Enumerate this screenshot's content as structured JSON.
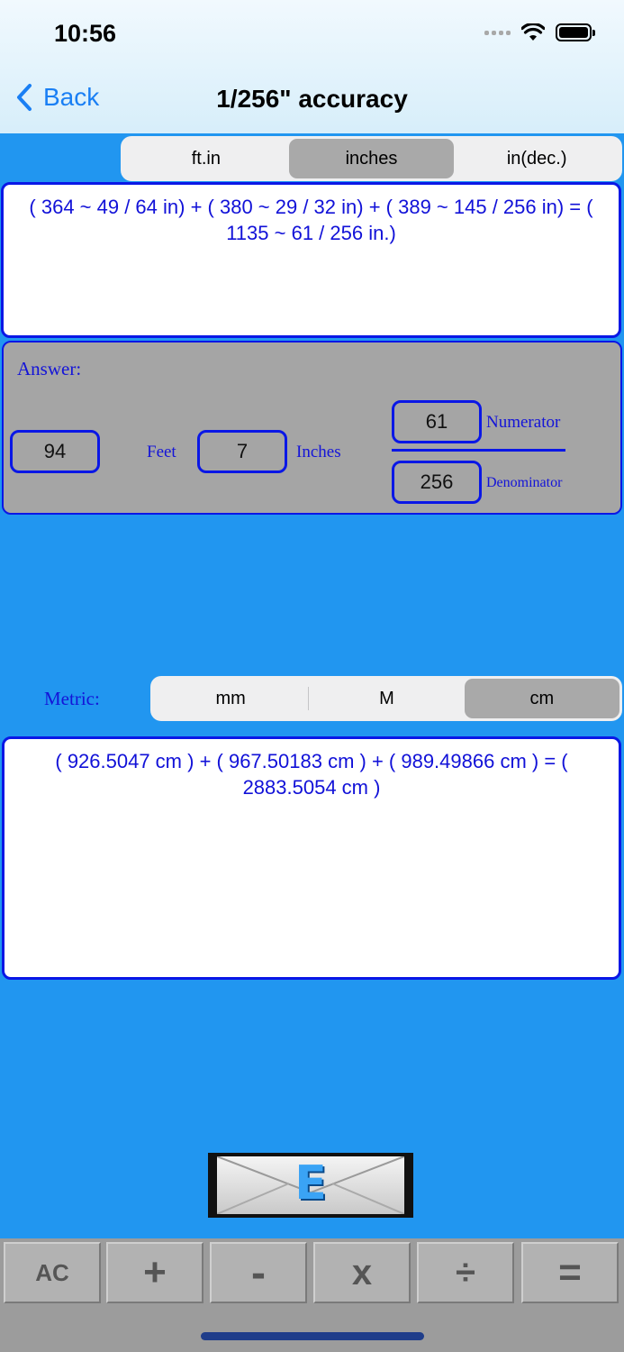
{
  "status_bar": {
    "time": "10:56"
  },
  "nav": {
    "back_label": "Back",
    "title": "1/256\" accuracy"
  },
  "imperial_units": {
    "options": [
      "ft.in",
      "inches",
      "in(dec.)"
    ],
    "selected": "inches"
  },
  "imperial_expression": "( 364 ~ 49 / 64 in)  +  ( 380 ~ 29 / 32 in)  +  ( 389 ~ 145 / 256 in)  =  ( 1135 ~ 61 / 256 in.)",
  "answer": {
    "heading": "Answer:",
    "feet_value": "94",
    "feet_label": "Feet",
    "inches_value": "7",
    "inches_label": "Inches",
    "numerator_value": "61",
    "numerator_label": "Numerator",
    "denominator_value": "256",
    "denominator_label": "Denominator"
  },
  "metric": {
    "label": "Metric:",
    "options": [
      "mm",
      "M",
      "cm"
    ],
    "selected": "cm",
    "expression": "( 926.5047 cm )  +  ( 967.50183 cm )  +  ( 989.49866 cm )  =  ( 2883.5054 cm )"
  },
  "email_button": {
    "letter": "E",
    "icon": "envelope-icon"
  },
  "keypad": [
    "AC",
    "+",
    "-",
    "x",
    "÷",
    "="
  ],
  "colors": {
    "background": "#2196f0",
    "accent_blue": "#0a17e6",
    "text_blue": "#1111d8",
    "ios_link": "#1a7ff4"
  }
}
